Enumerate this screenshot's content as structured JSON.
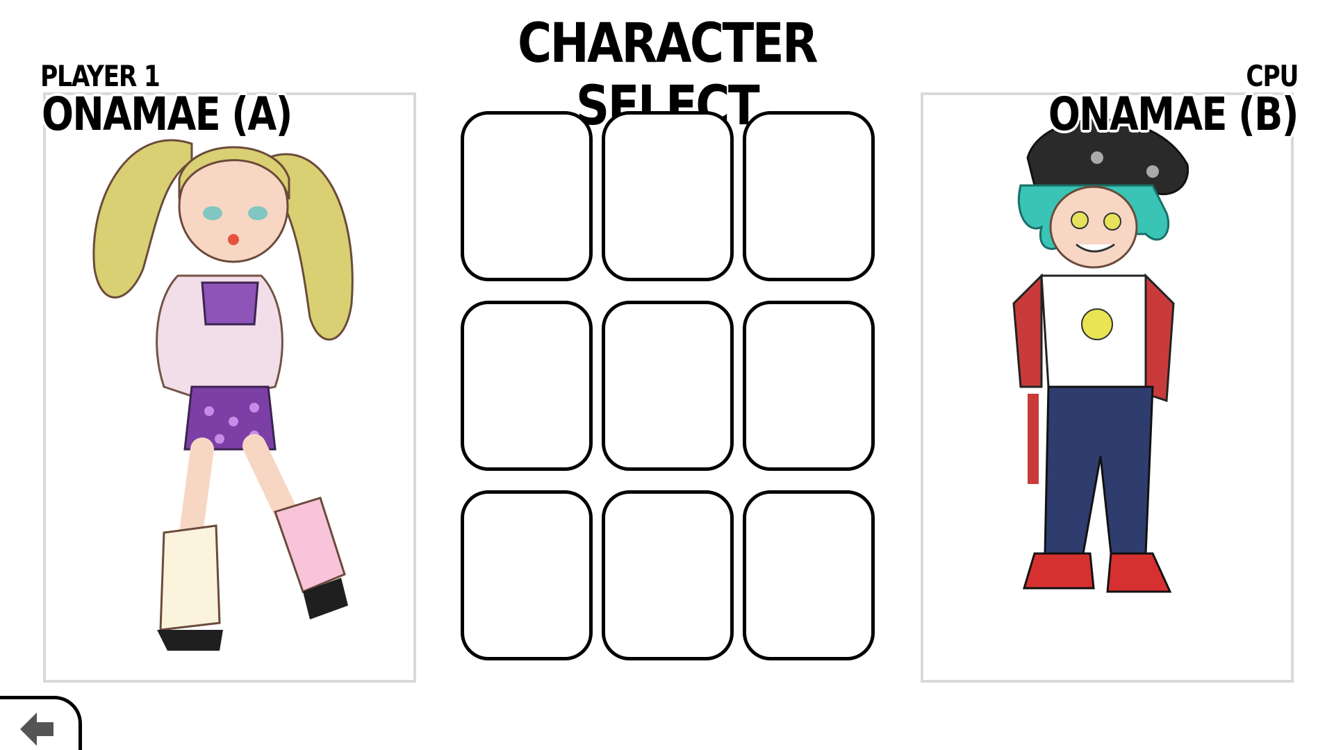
{
  "screen": {
    "title": "CHARACTER SELECT"
  },
  "player_left": {
    "tag": "PLAYER 1",
    "name": "ONAMAE (A)",
    "portrait_icon": "character-portrait-a"
  },
  "player_right": {
    "tag": "CPU",
    "name": "ONAMAE (B)",
    "portrait_icon": "character-portrait-b"
  },
  "roster": {
    "slots": [
      "",
      "",
      "",
      "",
      "",
      "",
      "",
      "",
      ""
    ]
  },
  "back_button": {
    "icon": "arrow-left-icon"
  },
  "colors": {
    "background": "#ffffff",
    "panel_border": "#d9d9d9",
    "slot_border": "#000000",
    "back_arrow": "#555555"
  }
}
